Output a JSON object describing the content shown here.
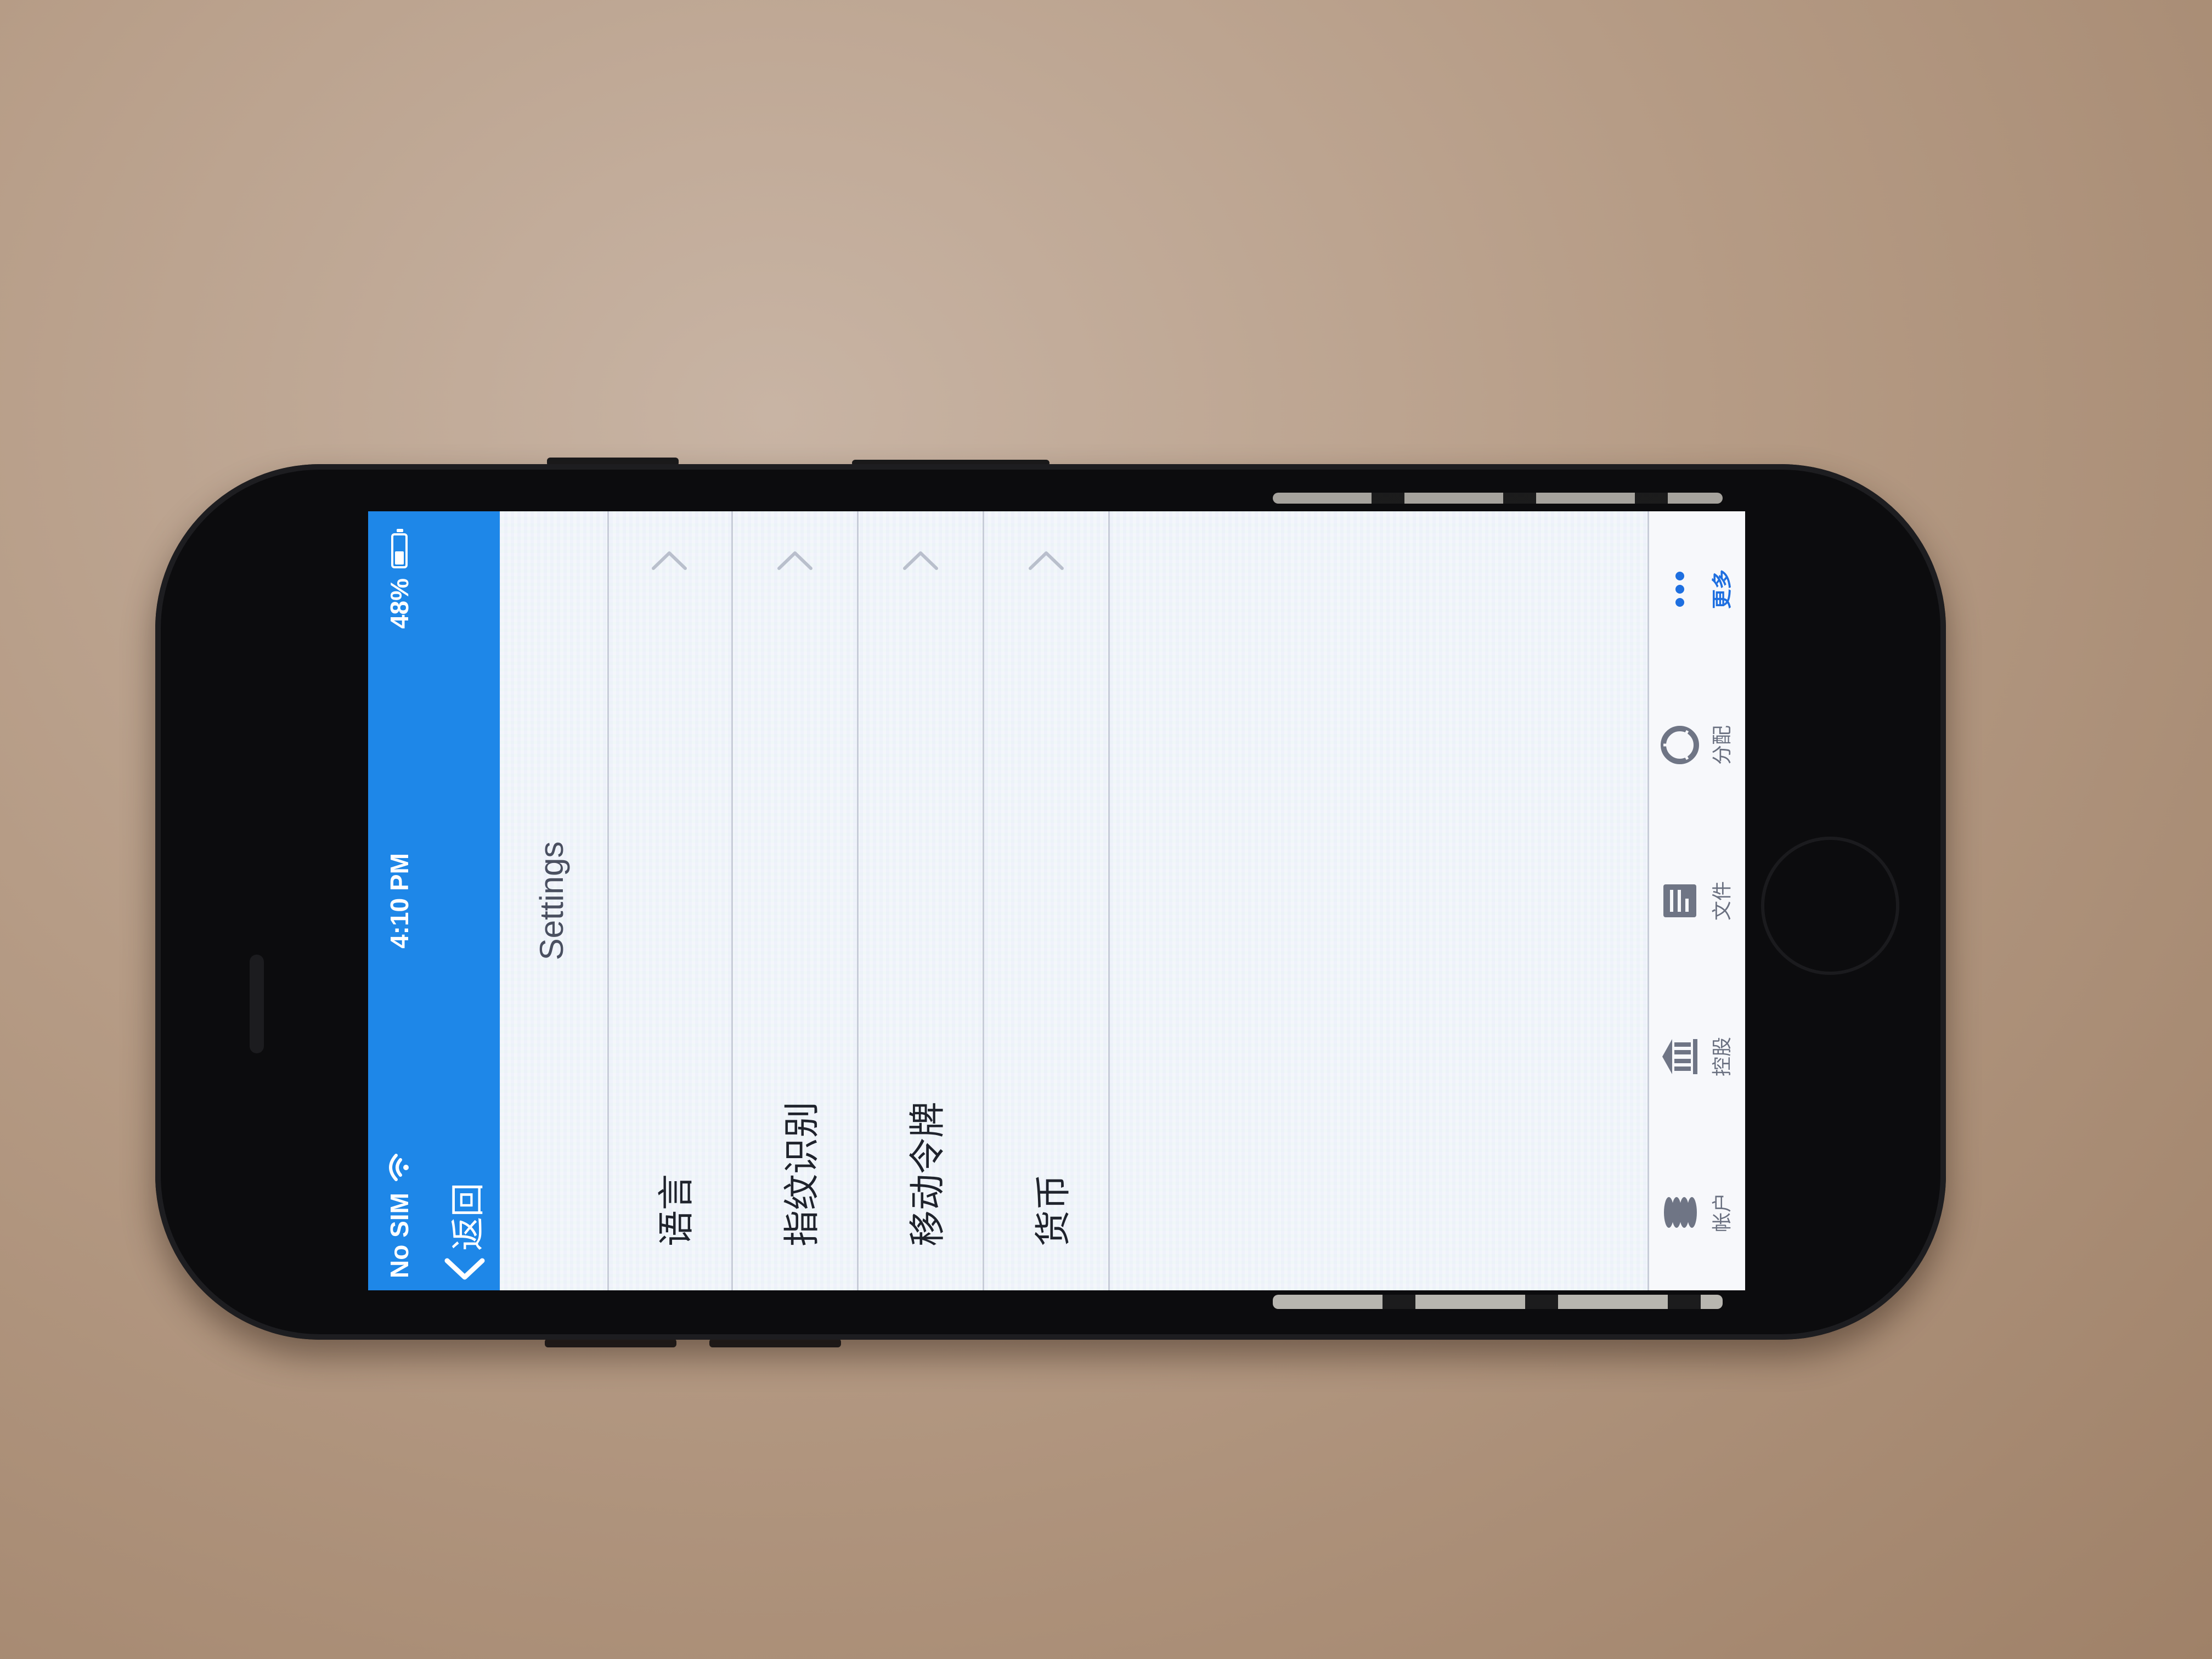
{
  "status_bar": {
    "carrier": "No SIM",
    "time": "4:10 PM",
    "battery_percent": "48%",
    "battery_level": 0.48
  },
  "nav": {
    "back_label": "返回"
  },
  "page": {
    "title": "Settings"
  },
  "settings": {
    "items": [
      {
        "label": "语言",
        "icon": "chevron-right-icon"
      },
      {
        "label": "指纹识别",
        "icon": "chevron-right-icon"
      },
      {
        "label": "移动令牌",
        "icon": "chevron-right-icon"
      },
      {
        "label": "货币",
        "icon": "chevron-right-icon"
      }
    ]
  },
  "tab_bar": {
    "items": [
      {
        "label": "帐户",
        "icon": "coins-icon",
        "active": false
      },
      {
        "label": "控股",
        "icon": "bank-icon",
        "active": false
      },
      {
        "label": "文件",
        "icon": "document-icon",
        "active": false
      },
      {
        "label": "分配",
        "icon": "pie-chart-icon",
        "active": false
      },
      {
        "label": "更多",
        "icon": "more-dots-icon",
        "active": true
      }
    ]
  },
  "colors": {
    "accent": "#1e87e8",
    "active_tab": "#1e6fe0",
    "text": "#1f232c",
    "divider": "#c7ccd8"
  }
}
